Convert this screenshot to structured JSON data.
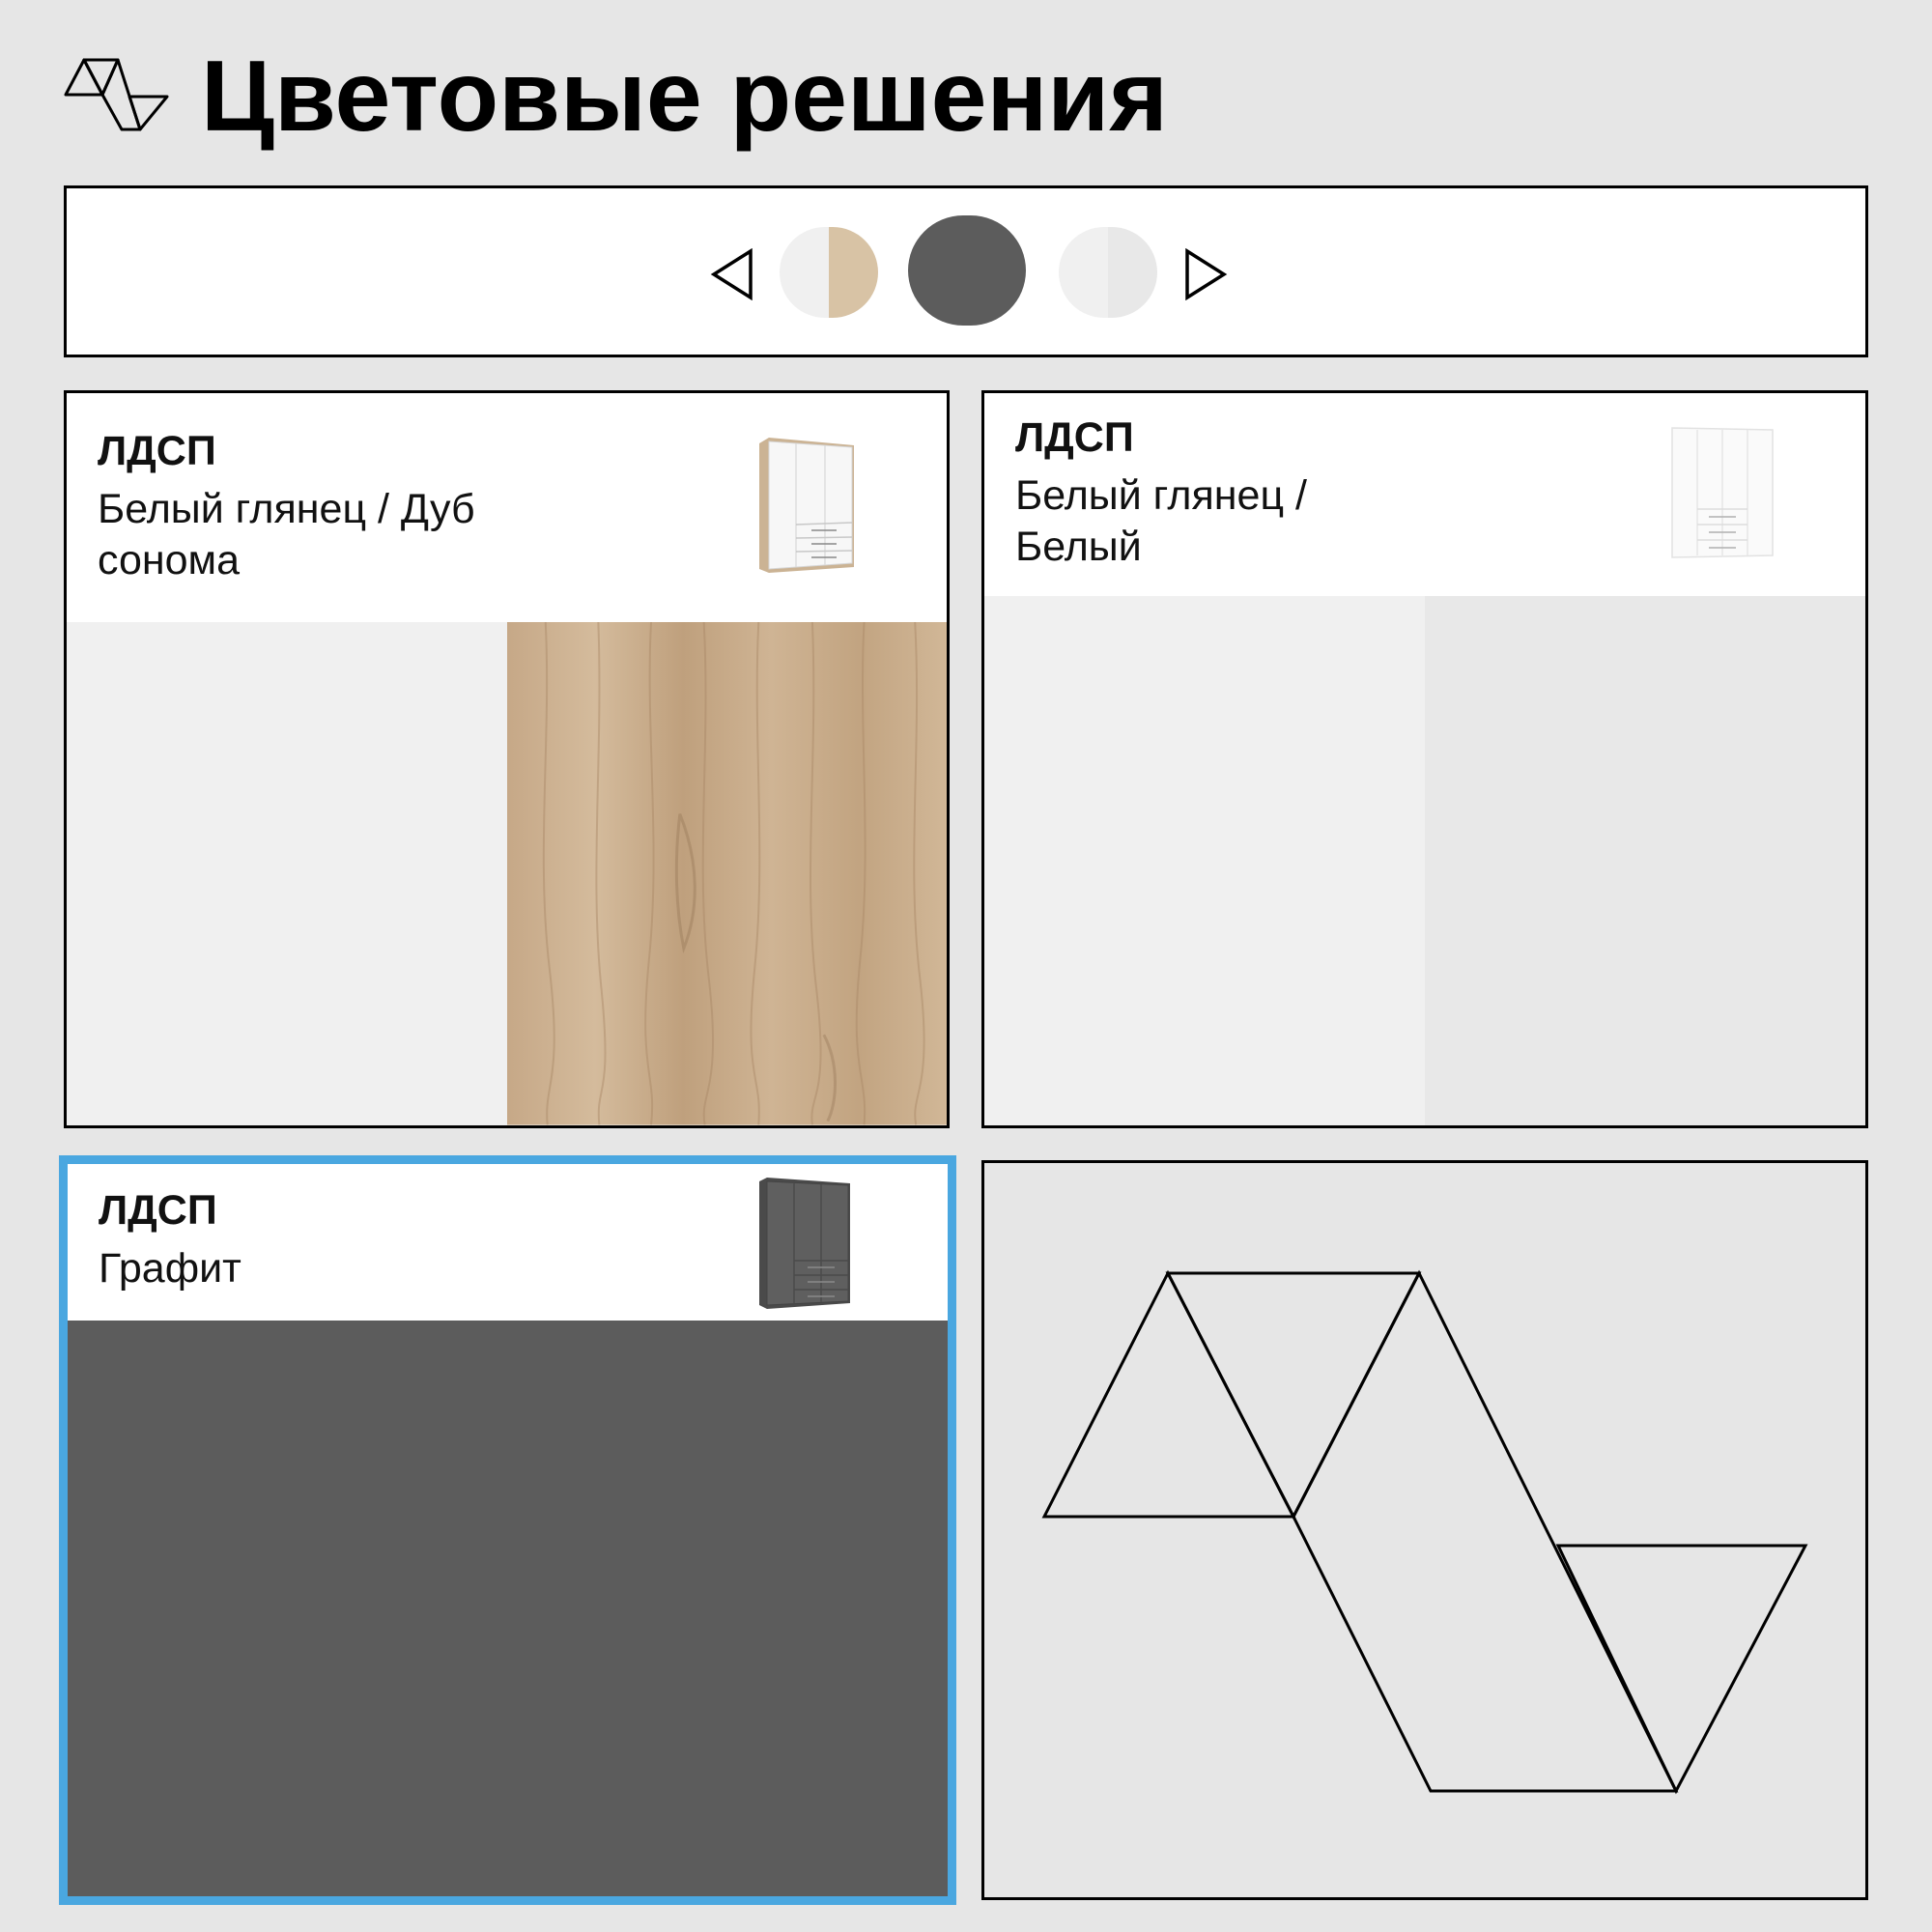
{
  "header": {
    "title": "Цветовые решения",
    "logo_icon": "triangles-logo-icon"
  },
  "selector": {
    "prev_icon": "triangle-left-icon",
    "next_icon": "triangle-right-icon",
    "swatches": [
      {
        "colors": [
          "#f0f0f0",
          "#d8c3a5"
        ]
      },
      {
        "colors": [
          "#5c5c5c"
        ],
        "selected": true
      },
      {
        "colors": [
          "#f0f0f0",
          "#e8e8e8"
        ]
      }
    ]
  },
  "cards": [
    {
      "material": "ЛДСП",
      "name": "Белый глянец / Дуб\nсонома",
      "colors": [
        "#f0f0f0",
        "#c9ad8c"
      ],
      "thumb_icon": "wardrobe-icon"
    },
    {
      "material": "ЛДСП",
      "name": "Белый глянец /\nБелый",
      "colors": [
        "#f0f0f0",
        "#e8e8e8"
      ],
      "thumb_icon": "wardrobe-icon"
    },
    {
      "material": "ЛДСП",
      "name": "Графит",
      "colors": [
        "#5c5c5c"
      ],
      "thumb_icon": "wardrobe-icon",
      "selected": true,
      "selection_color": "#4aa7e0"
    }
  ],
  "brand_card": {
    "icon": "triangles-logo-icon"
  }
}
